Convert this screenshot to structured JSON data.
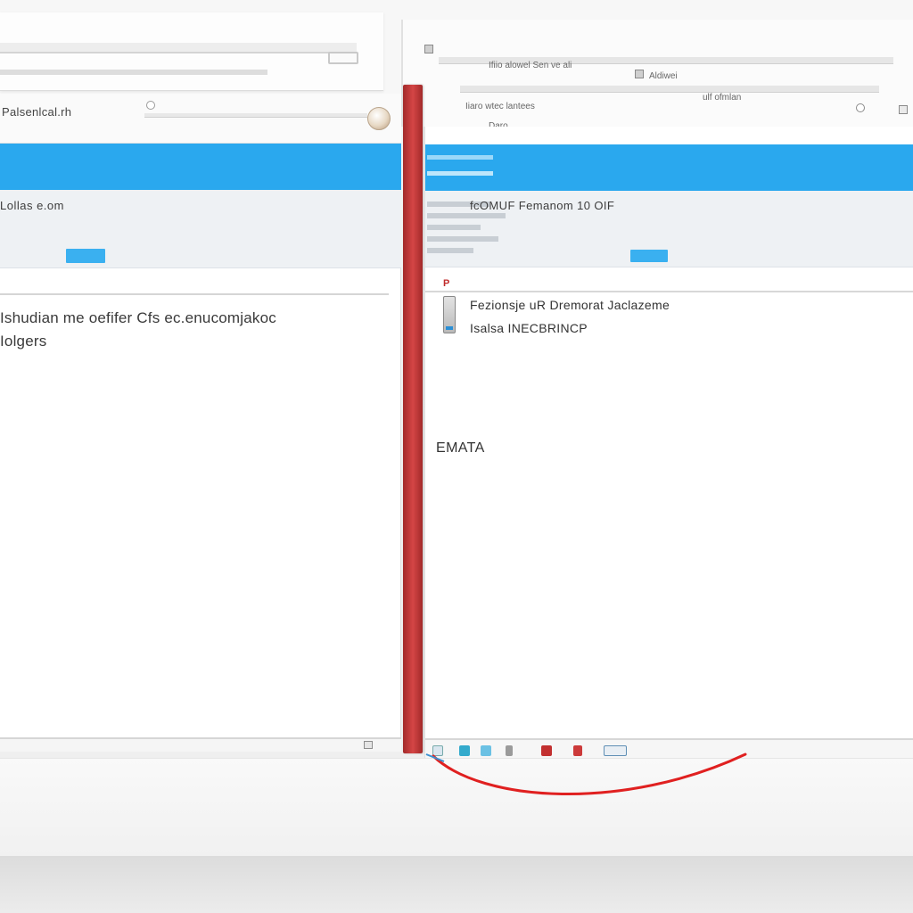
{
  "left_pane": {
    "title": "Palsenlcal.rh",
    "sub_label": "Lollas   e.om",
    "body_lines": [
      "Ishudian me oefifer Cfs ec.enucomjakoc",
      "Iolgers"
    ]
  },
  "right_pane": {
    "sub_label": "fcOMUF   Femanom   10 OIF",
    "red_mark": "P",
    "items": [
      "Fezionsje uR Dremorat Jaclazeme",
      "Isalsa INECBRINCP"
    ],
    "mid_label": "EMATA"
  },
  "top_right": {
    "labels": [
      "Ifiio alowel Sen ve ali",
      "Aldiwei",
      "Iiaro wtec lantees",
      "Daro",
      "ulf ofmlan"
    ]
  },
  "colors": {
    "banner_blue": "#2aa8ee",
    "divider_red": "#c13a3a",
    "cable_red": "#e02020"
  },
  "icons": {
    "taskbar": [
      "window-icon",
      "chart-icon",
      "chat-icon",
      "bars-icon",
      "app-red-icon",
      "flag-icon",
      "folder-icon"
    ]
  }
}
